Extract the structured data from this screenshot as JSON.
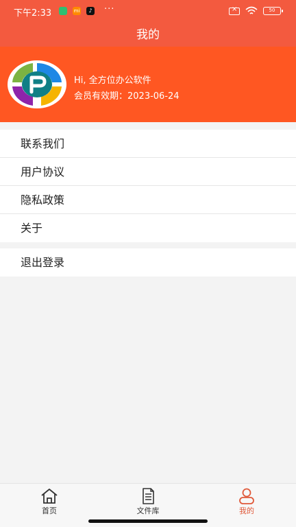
{
  "status_bar": {
    "time": "下午2:33",
    "app_mi": "mi",
    "app_tiktok": "♪",
    "dots": "···",
    "battery": "50"
  },
  "header": {
    "title": "我的"
  },
  "profile": {
    "greeting": "Hi, 全方位办公软件",
    "expiry": "会员有效期：2023-06-24"
  },
  "menu": {
    "items": [
      {
        "label": "联系我们"
      },
      {
        "label": "用户协议"
      },
      {
        "label": "隐私政策"
      },
      {
        "label": "关于"
      }
    ],
    "logout": "退出登录"
  },
  "tabbar": {
    "tabs": [
      {
        "label": "首页",
        "icon": "home-icon"
      },
      {
        "label": "文件库",
        "icon": "document-icon"
      },
      {
        "label": "我的",
        "icon": "person-icon"
      }
    ]
  },
  "colors": {
    "title_bar": "#f35a3f",
    "profile_bg": "#ff5722",
    "active_tab": "#e0593a"
  }
}
